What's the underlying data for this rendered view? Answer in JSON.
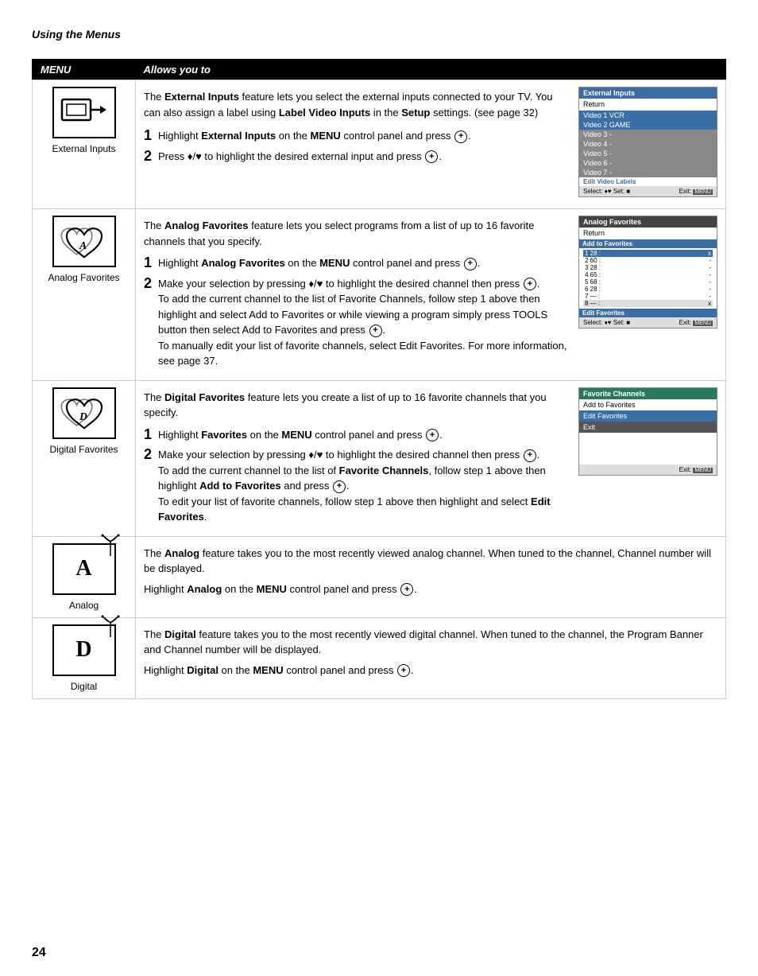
{
  "page": {
    "header": "Using the Menus",
    "page_number": "24"
  },
  "table": {
    "col_menu": "MENU",
    "col_allows": "Allows you to",
    "rows": [
      {
        "id": "external-inputs",
        "icon_label": "External Inputs",
        "icon_type": "external",
        "intro": "The External Inputs feature lets you select the external inputs connected to your TV. You can also assign a label using Label Video Inputs in the Setup settings. (see page 32)",
        "steps": [
          {
            "num": "1",
            "text": "Highlight External Inputs on the MENU control panel and press"
          },
          {
            "num": "2",
            "text": "Press ♦/♥ to highlight the desired external input and press"
          }
        ],
        "screenshot": {
          "title": "External Inputs",
          "return": "Return",
          "items": [
            {
              "label": "Video 1  VCR",
              "highlight": true
            },
            {
              "label": "Video 2  GAME",
              "highlight": true
            },
            {
              "label": "Video 3  -",
              "highlight": false
            },
            {
              "label": "Video 4  -",
              "highlight": false
            },
            {
              "label": "Video 5  -",
              "highlight": false
            },
            {
              "label": "Video 6  -",
              "highlight": false
            },
            {
              "label": "Video 7  -",
              "highlight": false
            },
            {
              "label": "Edit Video Labels",
              "highlight": false
            }
          ],
          "footer_select": "Select: ♦♥ Set: ■",
          "footer_exit": "Exit: MENU"
        }
      },
      {
        "id": "analog-favorites",
        "icon_label": "Analog Favorites",
        "icon_type": "heart-a",
        "intro": "The Analog Favorites feature lets you select programs from a list of up to 16 favorite channels that you specify.",
        "steps": [
          {
            "num": "1",
            "text": "Highlight Analog Favorites on the MENU control panel and press"
          },
          {
            "num": "2",
            "text": "Make your selection by pressing ♦/♥ to highlight the desired channel then press"
          }
        ],
        "extra_text": [
          "To add the current channel to the list of Favorite Channels, follow step 1 above then highlight and select Add to Favorites or while viewing a program simply press TOOLS button then select Add to Favorites and press",
          "To manually edit your list of favorite channels, select Edit Favorites. For more information, see page 37."
        ],
        "screenshot": {
          "title": "Analog Favorites",
          "return": "Return",
          "items_title": "Add to Favorites",
          "items": [
            {
              "num": "1",
              "ch": "28",
              "extra": "x",
              "highlight": true
            },
            {
              "num": "2",
              "ch": "60",
              "extra": "-",
              "highlight": false
            },
            {
              "num": "3",
              "ch": "28",
              "extra": "-",
              "highlight": false
            },
            {
              "num": "4",
              "ch": "65",
              "extra": "-",
              "highlight": false
            },
            {
              "num": "5",
              "ch": "68",
              "extra": "-",
              "highlight": false
            },
            {
              "num": "6",
              "ch": "28",
              "extra": "-",
              "highlight": false
            },
            {
              "num": "7",
              "ch": "—",
              "extra": "-",
              "highlight": false
            },
            {
              "num": "8",
              "ch": "—",
              "extra": "x",
              "highlight": false
            }
          ],
          "edit_label": "Edit Favorites",
          "footer_select": "Select: ♦♥ Set: ■",
          "footer_exit": "Exit: MENU"
        }
      },
      {
        "id": "digital-favorites",
        "icon_label": "Digital Favorites",
        "icon_type": "heart-d",
        "intro": "The Digital Favorites feature lets you create a list of up to 16 favorite channels that you specify.",
        "steps": [
          {
            "num": "1",
            "text": "Highlight Favorites on the MENU control panel and press"
          },
          {
            "num": "2",
            "text": "Make your selection by pressing ♦/♥ to highlight the desired channel then press"
          }
        ],
        "extra_text": [
          "To add the current channel to the list of Favorite Channels, follow step 1 above then highlight Add to Favorites and press",
          "To edit your list of favorite channels, follow step 1 above then highlight and select Edit Favorites."
        ],
        "screenshot": {
          "title": "Favorite Channels",
          "items": [
            {
              "label": "Add to Favorites",
              "highlight": false
            },
            {
              "label": "Edit Favorites",
              "highlight": true
            },
            {
              "label": "Exit",
              "dark": true
            }
          ],
          "footer_exit": "Exit: MENU"
        }
      },
      {
        "id": "analog",
        "icon_label": "Analog",
        "icon_type": "analog",
        "letter": "A",
        "intro": "The Analog feature takes you to the most recently viewed analog channel.  When tuned to the channel, Channel number will be displayed.",
        "instruction": "Highlight Analog on the MENU control panel and press"
      },
      {
        "id": "digital",
        "icon_label": "Digital",
        "icon_type": "digital",
        "letter": "D",
        "intro": "The Digital feature takes you to the most recently viewed digital channel.  When tuned to the channel, the Program Banner and Channel number will be displayed.",
        "instruction": "Highlight Digital on the MENU control panel and press"
      }
    ]
  }
}
